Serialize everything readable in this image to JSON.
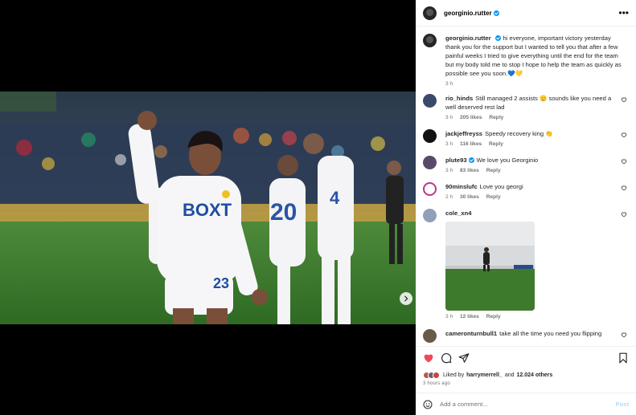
{
  "post": {
    "author": "georginio.rutter",
    "caption": "hi everyone, important victory yesterday thank you for the support but I wanted to tell you that after a few painful weeks I tried to give everything until the end for the team but my body told me to stop I hope to help the team as quickly as possible see you soon.💙💛",
    "caption_time": "3 h",
    "more_label": "•••",
    "photo_alt": "Leeds player celebrating"
  },
  "comments": [
    {
      "user": "rio_hinds",
      "verified": false,
      "text": "Still managed 2 assists 🫡 sounds like you need a well deserved rest lad",
      "time": "3 h",
      "likes": "205 likes",
      "reply": "Reply",
      "avatar_color": "#3a4a6b"
    },
    {
      "user": "jackjeffreyss",
      "verified": false,
      "text": "Speedy recovery king 👏",
      "time": "3 h",
      "likes": "116 likes",
      "reply": "Reply",
      "avatar_color": "#111111"
    },
    {
      "user": "plute93",
      "verified": true,
      "text": "We love you Georginio",
      "time": "3 h",
      "likes": "83 likes",
      "reply": "Reply",
      "avatar_color": "#5a4a6a"
    },
    {
      "user": "90minslufc",
      "verified": false,
      "text": "Love you georgi",
      "time": "2 h",
      "likes": "30 likes",
      "reply": "Reply",
      "avatar_color": "#f0f0f0"
    },
    {
      "user": "cole_xn4",
      "verified": false,
      "text": "",
      "time": "3 h",
      "likes": "12 likes",
      "reply": "Reply",
      "avatar_color": "#8fa0b8"
    },
    {
      "user": "cameronturnbull1",
      "verified": false,
      "text": "take all the time you need you flipping",
      "time": "",
      "likes": "",
      "reply": "",
      "avatar_color": "#6a5a4a"
    }
  ],
  "actions": {
    "liked_by_prefix": "Liked by",
    "liked_by_user": "harrymerrell_",
    "liked_by_mid": "and",
    "liked_by_count": "12.024 others",
    "timestamp": "3 hours ago"
  },
  "comment_box": {
    "placeholder": "Add a comment...",
    "post_label": "Post"
  },
  "colors": {
    "accent_heart": "#ed4956",
    "verified": "#0095f6",
    "post_disabled": "#b3dbff"
  }
}
